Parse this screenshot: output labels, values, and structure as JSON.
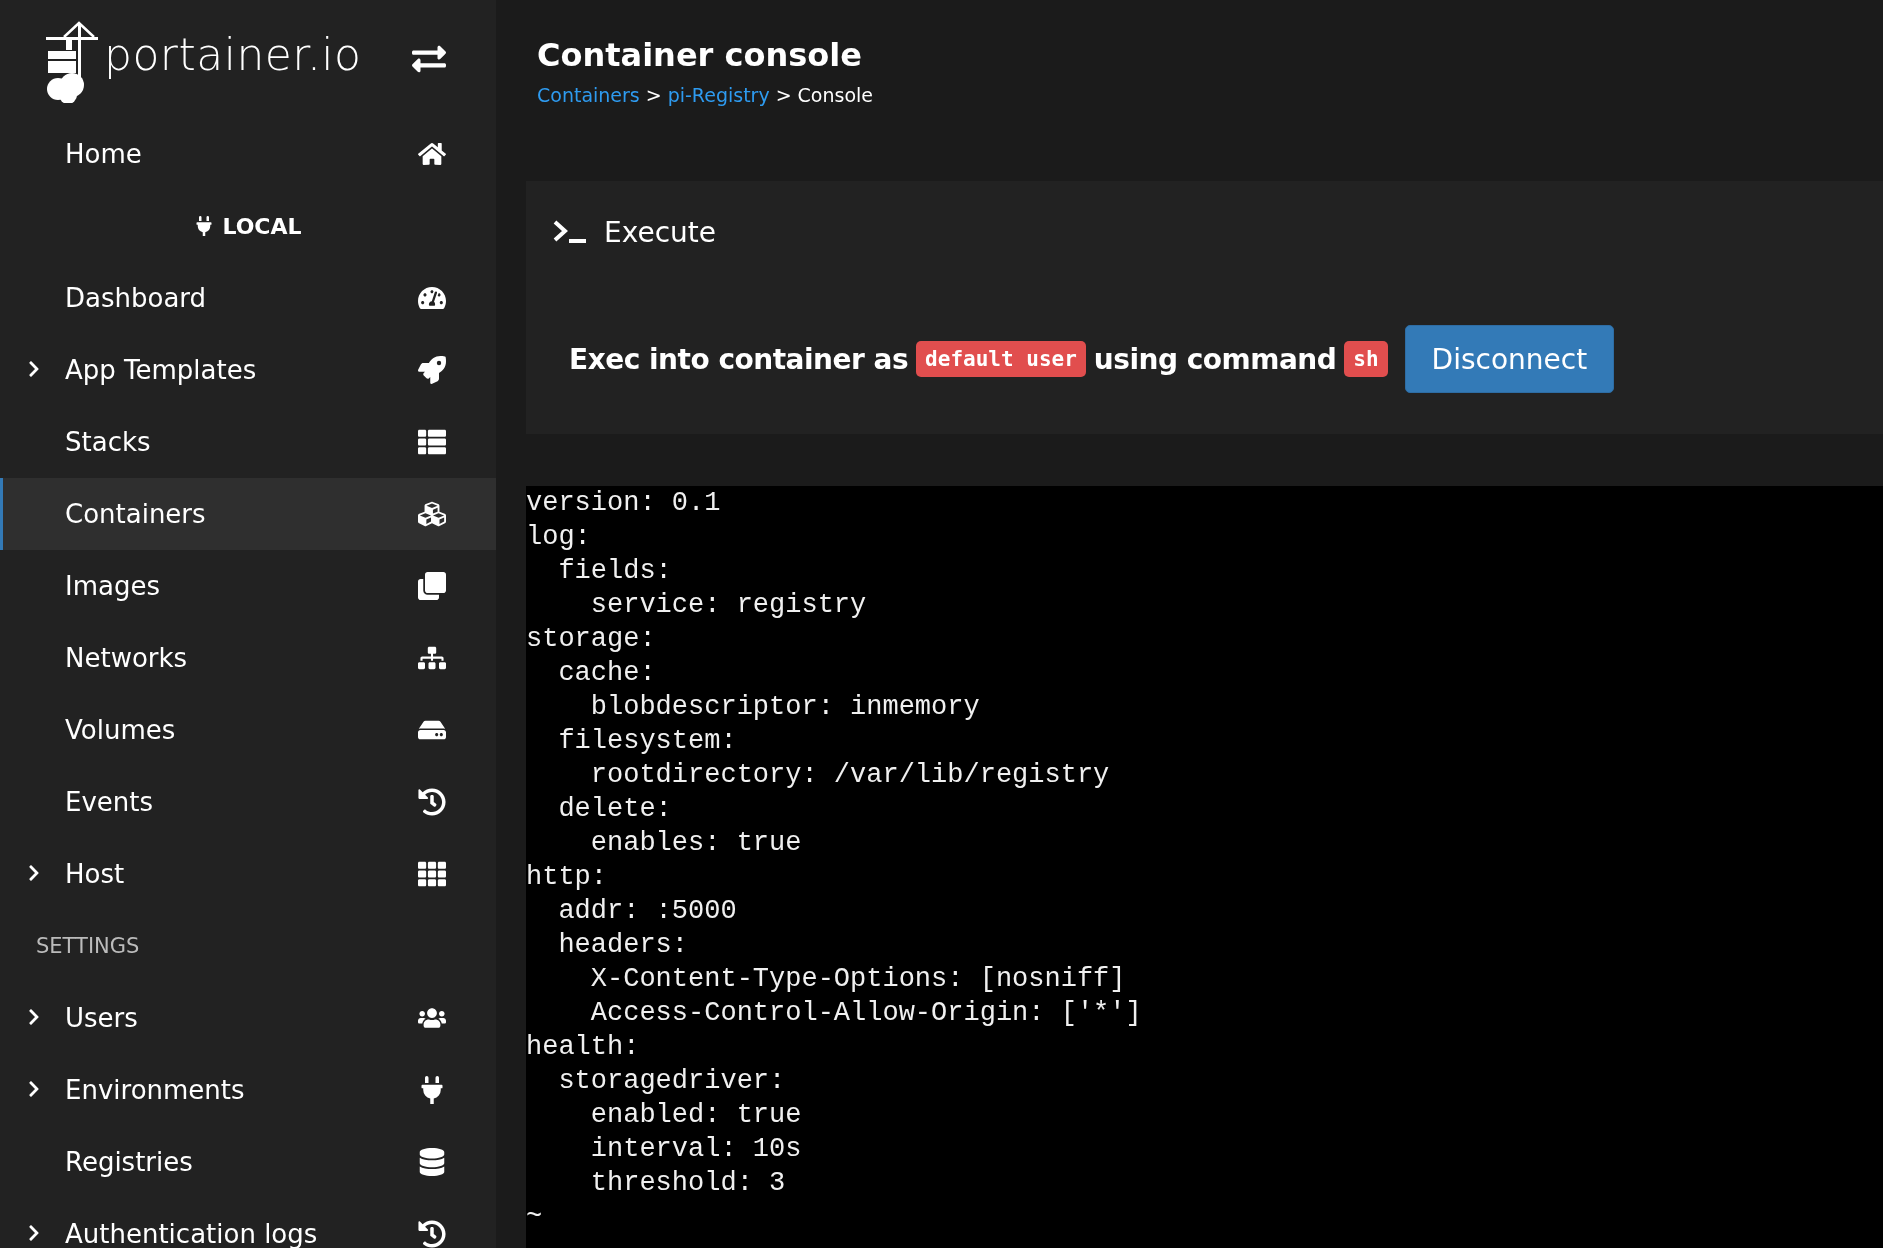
{
  "sidebar": {
    "logo": "portainer.io",
    "items": [
      {
        "kind": "item",
        "label": "Home",
        "expandable": false,
        "selected": false
      },
      {
        "kind": "environment",
        "label": "LOCAL"
      },
      {
        "kind": "item",
        "label": "Dashboard",
        "expandable": false,
        "selected": false
      },
      {
        "kind": "item",
        "label": "App Templates",
        "expandable": true,
        "selected": false
      },
      {
        "kind": "item",
        "label": "Stacks",
        "expandable": false,
        "selected": false
      },
      {
        "kind": "item",
        "label": "Containers",
        "expandable": false,
        "selected": true
      },
      {
        "kind": "item",
        "label": "Images",
        "expandable": false,
        "selected": false
      },
      {
        "kind": "item",
        "label": "Networks",
        "expandable": false,
        "selected": false
      },
      {
        "kind": "item",
        "label": "Volumes",
        "expandable": false,
        "selected": false
      },
      {
        "kind": "item",
        "label": "Events",
        "expandable": false,
        "selected": false
      },
      {
        "kind": "item",
        "label": "Host",
        "expandable": true,
        "selected": false
      },
      {
        "kind": "heading",
        "label": "SETTINGS"
      },
      {
        "kind": "item",
        "label": "Users",
        "expandable": true,
        "selected": false
      },
      {
        "kind": "item",
        "label": "Environments",
        "expandable": true,
        "selected": false
      },
      {
        "kind": "item",
        "label": "Registries",
        "expandable": false,
        "selected": false
      },
      {
        "kind": "item",
        "label": "Authentication logs",
        "expandable": true,
        "selected": false
      }
    ]
  },
  "header": {
    "title": "Container console",
    "breadcrumbs": [
      {
        "label": "Containers",
        "link": true
      },
      {
        "label": "pi-Registry",
        "link": true
      },
      {
        "label": "Console",
        "link": false
      }
    ],
    "separator": ">"
  },
  "panel": {
    "title": "Execute",
    "exec": {
      "before": "Exec into container as",
      "user": "default user",
      "middle": "using command",
      "command": "sh"
    },
    "button": "Disconnect"
  },
  "terminal": {
    "lines": [
      "version: 0.1",
      "log:",
      "  fields:",
      "    service: registry",
      "storage:",
      "  cache:",
      "    blobdescriptor: inmemory",
      "  filesystem:",
      "    rootdirectory: /var/lib/registry",
      "  delete:",
      "    enables: true",
      "http:",
      "  addr: :5000",
      "  headers:",
      "    X-Content-Type-Options: [nosniff]",
      "    Access-Control-Allow-Origin: ['*']",
      "health:",
      "  storagedriver:",
      "    enabled: true",
      "    interval: 10s",
      "    threshold: 3",
      "~"
    ]
  }
}
